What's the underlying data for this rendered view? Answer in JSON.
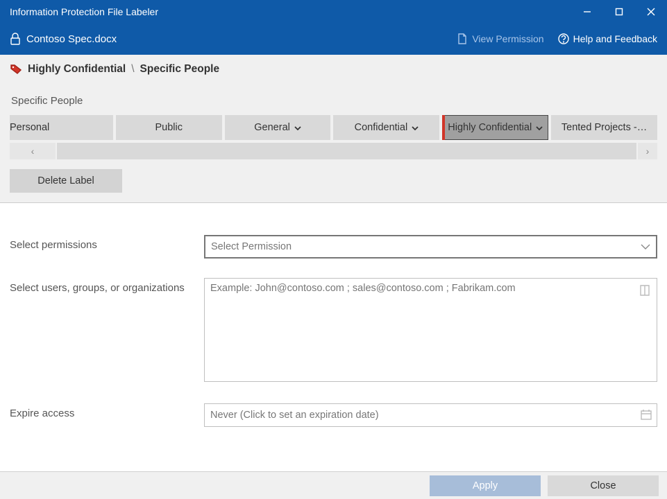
{
  "window": {
    "title": "Information Protection File Labeler"
  },
  "toolbar": {
    "filename": "Contoso Spec.docx",
    "view_permission": "View Permission",
    "help_feedback": "Help and Feedback"
  },
  "breadcrumb": {
    "level1": "Highly Confidential",
    "separator": "\\",
    "level2": "Specific People"
  },
  "sub_description": "Specific People",
  "label_tabs": [
    {
      "label": "Personal",
      "has_caret": false
    },
    {
      "label": "Public",
      "has_caret": false
    },
    {
      "label": "General",
      "has_caret": true
    },
    {
      "label": "Confidential",
      "has_caret": true
    },
    {
      "label": "Highly Confidential",
      "has_caret": true,
      "selected": true
    },
    {
      "label": "Tented Projects -…",
      "has_caret": false
    }
  ],
  "delete_label_btn": "Delete Label",
  "form": {
    "permissions_label": "Select permissions",
    "permissions_placeholder": "Select Permission",
    "users_label": "Select users, groups, or organizations",
    "users_placeholder": "Example: John@contoso.com ; sales@contoso.com ; Fabrikam.com",
    "expire_label": "Expire access",
    "expire_placeholder": "Never (Click to set an expiration date)"
  },
  "footer": {
    "apply": "Apply",
    "close": "Close"
  }
}
